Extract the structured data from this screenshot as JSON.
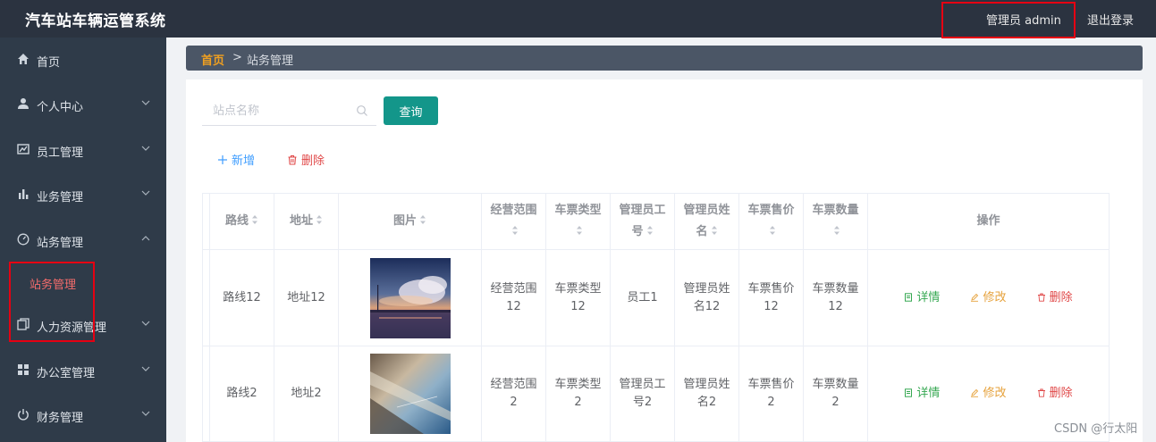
{
  "app": {
    "title": "汽车站车辆运管系统"
  },
  "header": {
    "user": "管理员 admin",
    "logout": "退出登录"
  },
  "sidebar": {
    "items": [
      {
        "label": "首页",
        "icon": "home-icon"
      },
      {
        "label": "个人中心",
        "icon": "user-icon"
      },
      {
        "label": "员工管理",
        "icon": "chart-icon"
      },
      {
        "label": "业务管理",
        "icon": "bar-chart-icon"
      },
      {
        "label": "站务管理",
        "icon": "dashboard-icon"
      },
      {
        "label": "人力资源管理",
        "icon": "copy-icon"
      },
      {
        "label": "办公室管理",
        "icon": "grid-icon"
      },
      {
        "label": "财务管理",
        "icon": "power-icon"
      }
    ],
    "active_sub": "站务管理"
  },
  "breadcrumb": {
    "home": "首页",
    "sep": ">",
    "current": "站务管理"
  },
  "search": {
    "placeholder": "站点名称",
    "button": "查询"
  },
  "actions": {
    "add": "新增",
    "delete": "删除"
  },
  "table": {
    "columns": {
      "route": "路线",
      "address": "地址",
      "image": "图片",
      "scope": "经营范围",
      "ticket_type": "车票类型",
      "admin_id_a": "管理员工",
      "admin_id_b": "号",
      "admin_name_a": "管理员姓",
      "admin_name_b": "名",
      "price": "车票售价",
      "count": "车票数量",
      "ops": "操作"
    },
    "rows": [
      {
        "route": "路线12",
        "address": "地址12",
        "scope_a": "经营范围",
        "scope_b": "12",
        "type_a": "车票类型",
        "type_b": "12",
        "admin_id_a": "员工1",
        "admin_id_b": "",
        "name_a": "管理员姓",
        "name_b": "名12",
        "price_a": "车票售价",
        "price_b": "12",
        "count_a": "车票数量",
        "count_b": "12"
      },
      {
        "route": "路线2",
        "address": "地址2",
        "scope_a": "经营范围",
        "scope_b": "2",
        "type_a": "车票类型",
        "type_b": "2",
        "admin_id_a": "管理员工",
        "admin_id_b": "号2",
        "name_a": "管理员姓",
        "name_b": "名2",
        "price_a": "车票售价",
        "price_b": "2",
        "count_a": "车票数量",
        "count_b": "2"
      }
    ],
    "op_labels": {
      "detail": "详情",
      "edit": "修改",
      "delete": "删除"
    }
  },
  "watermark": "CSDN @行太阳",
  "colors": {
    "topbar": "#2b3340",
    "sidebar": "#2f3b49",
    "accent": "#13968a",
    "highlight": "#e60012",
    "crumb_home": "#f0a020"
  }
}
